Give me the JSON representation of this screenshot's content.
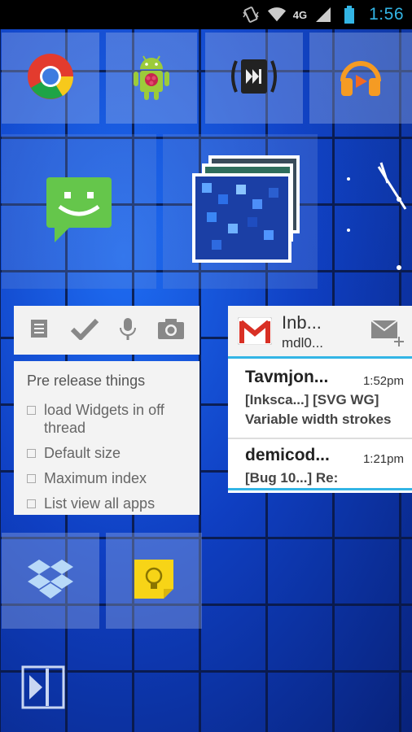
{
  "status_bar": {
    "time": "1:56",
    "network": "4G",
    "icons": [
      "vibrate-icon",
      "wifi-icon",
      "signal-icon",
      "battery-icon"
    ]
  },
  "apps": [
    {
      "name": "Chrome",
      "icon": "chrome-icon"
    },
    {
      "name": "Raspberry Pi",
      "icon": "android-raspberry-icon"
    },
    {
      "name": "Media",
      "icon": "media-vibrate-icon"
    },
    {
      "name": "Play Music",
      "icon": "headphones-icon"
    },
    {
      "name": "Messaging",
      "icon": "messaging-icon"
    },
    {
      "name": "Gallery",
      "icon": "gallery-icon"
    },
    {
      "name": "Dropbox",
      "icon": "dropbox-icon"
    },
    {
      "name": "Keep",
      "icon": "keep-icon"
    }
  ],
  "keep_widget": {
    "toolbar_icons": [
      "note-icon",
      "checkmark-icon",
      "microphone-icon",
      "camera-icon"
    ],
    "note_title": "Pre release things",
    "items": [
      " load Widgets in off thread",
      "Default size",
      "Maximum index",
      "List view all apps"
    ]
  },
  "gmail_widget": {
    "folder": "Inb...",
    "account": "mdl0...",
    "messages": [
      {
        "from": "Tavmjon...",
        "time": "1:52pm",
        "line1": "[Inksca...] [SVG WG]",
        "line2": "Variable width strokes"
      },
      {
        "from": "demicod...",
        "time": "1:21pm",
        "line1": "[Bug 10...] Re:",
        "line2": ""
      }
    ]
  },
  "colors": {
    "accent": "#33b5e5",
    "wallpaper": "#0f3fc2",
    "tile": "#aabeeb"
  }
}
